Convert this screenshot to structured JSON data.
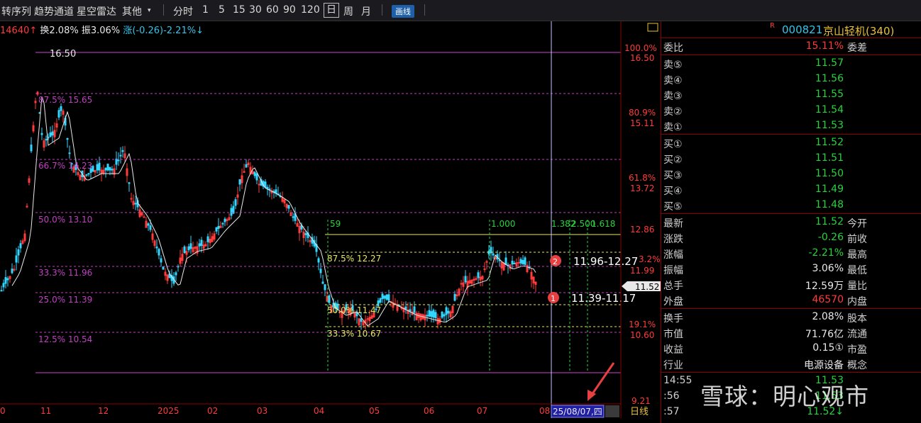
{
  "toolbar": {
    "items": [
      "转序列",
      "趋势通道",
      "星空雷达",
      "其他",
      "分时",
      "1",
      "5",
      "15",
      "30",
      "60",
      "90",
      "120",
      "日",
      "周",
      "月"
    ],
    "draw_badge": "画线"
  },
  "info_bar": {
    "vol": "14640",
    "turnover": "换2.08%",
    "amplitude": "振3.06%",
    "change": "涨(-0.26)-2.21%"
  },
  "chart": {
    "high_label": "16.50",
    "fib_levels": [
      {
        "text": "87.5% 15.65"
      },
      {
        "text": "66.7% 14.23"
      },
      {
        "text": "50.0% 13.10"
      },
      {
        "text": "33.3% 11.96"
      },
      {
        "text": "25.0% 11.39"
      },
      {
        "text": "12.5% 10.54"
      }
    ],
    "inner_fib": [
      {
        "text": "87.5% 12.27"
      },
      {
        "text": "50.0% 11.47"
      },
      {
        "text": "33.3% 10.67"
      }
    ],
    "time_markers": [
      "59",
      "1.000",
      "1.382",
      "2.500",
      "1.618"
    ],
    "zones": [
      {
        "num": "2",
        "range": "11.96-12.27"
      },
      {
        "num": "1",
        "range": "11.39-11.17"
      }
    ],
    "axis_right": [
      {
        "pct": "100.0%",
        "price": "16.50"
      },
      {
        "pct": "80.9%",
        "price": "15.11"
      },
      {
        "pct": "61.8%",
        "price": "13.72"
      },
      {
        "pct": "",
        "price": "12.86"
      },
      {
        "pct": "3.2%",
        "price": "11.99"
      },
      {
        "pct": "19.1%",
        "price": "10.60"
      },
      {
        "pct": "",
        "price": "9.21"
      }
    ],
    "current_price": "11.52",
    "x_labels": [
      "0",
      "11",
      "12",
      "2025",
      "02",
      "03",
      "04",
      "05",
      "06",
      "07",
      "08"
    ],
    "date_label": "25/08/07,四",
    "period_label": "日线"
  },
  "panel": {
    "code": "000821",
    "name": "京山轻机(340)",
    "r_mark": "R",
    "weibi": {
      "label": "委比",
      "value": "15.11%",
      "label2": "委差"
    },
    "sells": [
      {
        "label": "卖⑤",
        "value": "11.57"
      },
      {
        "label": "卖④",
        "value": "11.56"
      },
      {
        "label": "卖③",
        "value": "11.55"
      },
      {
        "label": "卖②",
        "value": "11.54"
      },
      {
        "label": "卖①",
        "value": "11.53"
      }
    ],
    "buys": [
      {
        "label": "买①",
        "value": "11.52"
      },
      {
        "label": "买②",
        "value": "11.51"
      },
      {
        "label": "买③",
        "value": "11.50"
      },
      {
        "label": "买④",
        "value": "11.49"
      },
      {
        "label": "买⑤",
        "value": "11.48"
      }
    ],
    "quote": [
      {
        "label": "最新",
        "value": "11.52",
        "label2": "今开",
        "color": "green"
      },
      {
        "label": "涨跌",
        "value": "-0.26",
        "label2": "前收",
        "color": "green"
      },
      {
        "label": "涨幅",
        "value": "-2.21%",
        "label2": "最高",
        "color": "green"
      },
      {
        "label": "振幅",
        "value": "3.06%",
        "label2": "最低",
        "color": "white"
      },
      {
        "label": "总手",
        "value": "12.59万",
        "label2": "量比",
        "color": "white"
      },
      {
        "label": "外盘",
        "value": "46570",
        "label2": "内盘",
        "color": "red"
      }
    ],
    "stats": [
      {
        "label": "换手",
        "value": "2.08%",
        "label2": "股本",
        "color": "white"
      },
      {
        "label": "市值",
        "value": "71.76亿",
        "label2": "流通",
        "color": "white"
      },
      {
        "label": "收益",
        "value": "0.15①",
        "label2": "市盈",
        "color": "white"
      },
      {
        "label": "行业",
        "value": "电源设备",
        "label2": "概念",
        "color": "white"
      }
    ],
    "ticks": [
      {
        "time": "14:55",
        "value": "11.53"
      },
      {
        "time": ":56",
        "value": "11.53"
      },
      {
        "time": ":57",
        "value": "11.52↓"
      }
    ],
    "watermark": "雪球：明心观市"
  },
  "colors": {
    "magenta": "#c040c0",
    "yellow": "#e8e860",
    "green": "#27d33c",
    "red": "#ff3b3b"
  }
}
